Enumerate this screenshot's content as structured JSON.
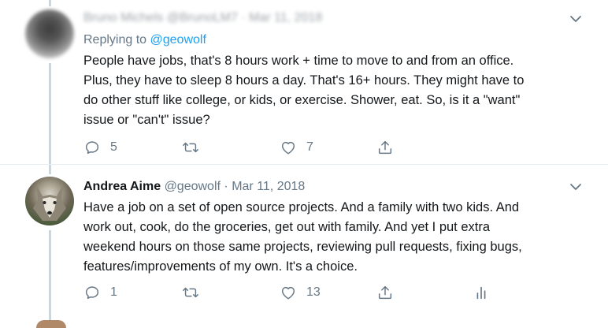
{
  "tweets": [
    {
      "author_name": "Bruno Michels",
      "handle": "@BrunoLM7",
      "date": "Mar 11, 2018",
      "replying_prefix": "Replying to",
      "replying_to": "@geowolf",
      "text_lines": [
        "People have jobs, that's 8 hours work + time to move to and from an office.",
        "Plus, they have to sleep 8 hours a day. That's 16+ hours. They might have to",
        "do other stuff like college, or kids, or exercise. Shower, eat. So, is it a \"want\"",
        "issue or \"can't\" issue?"
      ],
      "reply_count": "5",
      "like_count": "7"
    },
    {
      "author_name": "Andrea Aime",
      "handle": "@geowolf",
      "dot": "·",
      "date": "Mar 11, 2018",
      "text_lines": [
        "Have a job on a set of open source projects. And a family with two kids. And",
        "work out, cook, do the groceries, get out with family. And yet I put extra",
        "weekend hours on those same projects, reviewing pull requests, fixing bugs,",
        "features/improvements of my own. It's a choice."
      ],
      "reply_count": "1",
      "like_count": "13"
    }
  ],
  "colors": {
    "accent": "#1da1f2",
    "muted": "#657786",
    "thread_line": "#ccd6dd",
    "text": "#14171a"
  },
  "icons": [
    "chevron-down-icon",
    "reply-icon",
    "retweet-icon",
    "like-icon",
    "share-icon",
    "analytics-icon"
  ]
}
